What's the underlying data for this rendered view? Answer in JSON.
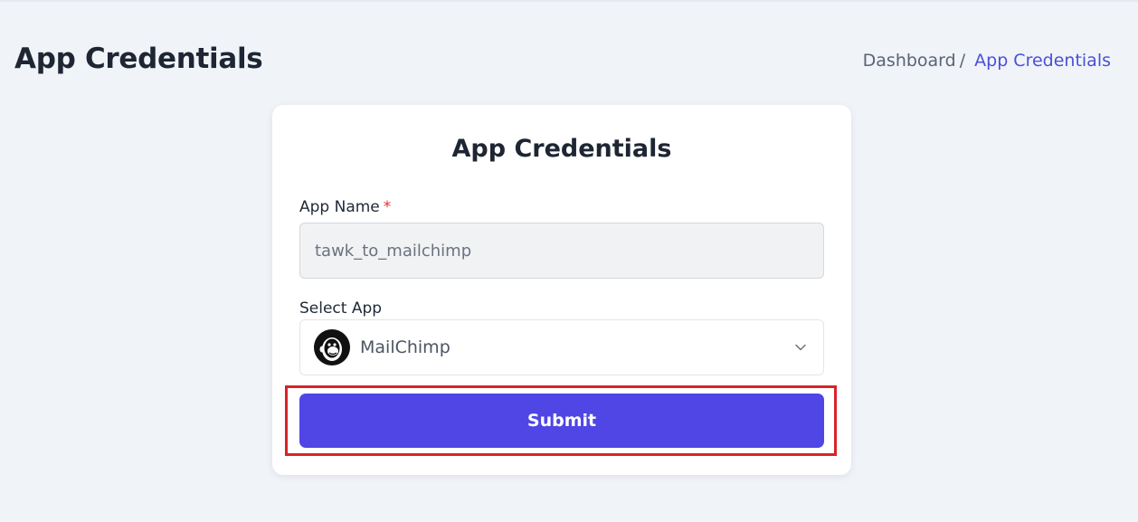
{
  "header": {
    "title": "App Credentials",
    "breadcrumb": {
      "home": "Dashboard",
      "separator": "/",
      "current": "App Credentials"
    }
  },
  "form": {
    "title": "App Credentials",
    "app_name": {
      "label": "App Name",
      "required_mark": "*",
      "value": "tawk_to_mailchimp"
    },
    "select_app": {
      "label": "Select App",
      "selected_value": "MailChimp",
      "selected_icon": "mailchimp-logo-icon",
      "dropdown_icon": "chevron-down-icon"
    },
    "submit_label": "Submit"
  },
  "colors": {
    "background": "#f0f3f8",
    "accent": "#4f46e5",
    "breadcrumb_active": "#4a50d6",
    "required": "#e03131",
    "highlight_outline": "#d8232a"
  }
}
